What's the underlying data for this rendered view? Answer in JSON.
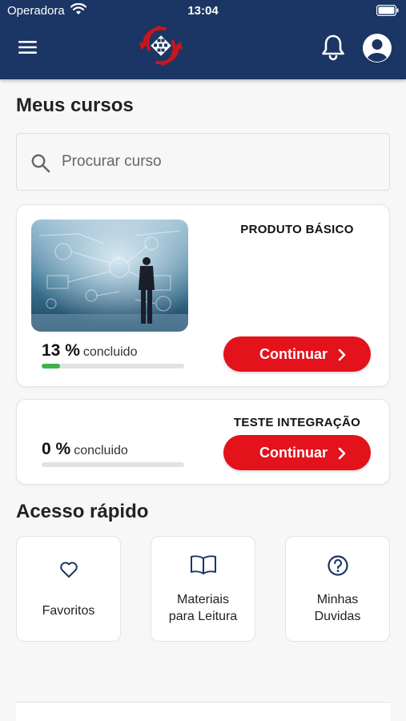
{
  "status_bar": {
    "carrier": "Operadora",
    "time": "13:04"
  },
  "header": {
    "logo_icon": "brand-logo-icon",
    "menu_icon": "hamburger-icon",
    "notifications_icon": "bell-icon",
    "profile_icon": "user-circle-icon"
  },
  "colors": {
    "header_bg": "#1b3564",
    "accent_red": "#e3121b",
    "progress_green": "#3bb54a"
  },
  "my_courses": {
    "title": "Meus cursos",
    "search_placeholder": "Procurar curso",
    "courses": [
      {
        "title": "PRODUTO BÁSICO",
        "percent": "13 %",
        "progress": 0.13,
        "progress_label": "concluido",
        "button": "Continuar"
      },
      {
        "title": "TESTE INTEGRAÇÃO",
        "percent": "0 %",
        "progress": 0,
        "progress_label": "concluido",
        "button": "Continuar"
      }
    ]
  },
  "quick_access": {
    "title": "Acesso rápido",
    "items": [
      {
        "label": "Favoritos",
        "icon": "heart-icon"
      },
      {
        "label": "Materiais\npara Leitura",
        "icon": "book-icon"
      },
      {
        "label": "Minhas\nDuvidas",
        "icon": "help-circle-icon"
      }
    ]
  }
}
